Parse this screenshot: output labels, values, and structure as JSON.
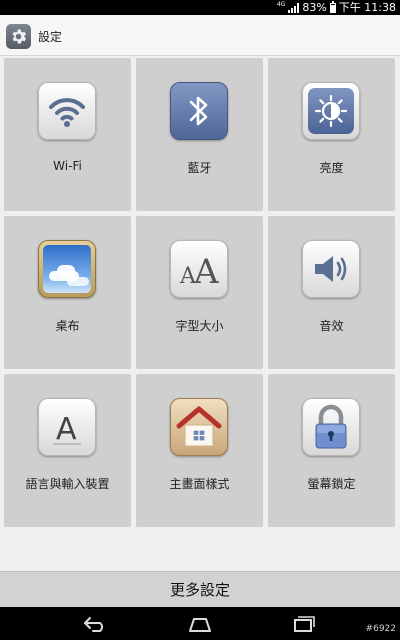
{
  "status_bar": {
    "network": "4G",
    "battery_percent": "83%",
    "time": "下午 11:38"
  },
  "header": {
    "icon": "gear-icon",
    "title": "設定"
  },
  "tiles": [
    {
      "label": "Wi-Fi",
      "icon": "wifi-icon"
    },
    {
      "label": "藍牙",
      "icon": "bluetooth-icon"
    },
    {
      "label": "亮度",
      "icon": "brightness-icon"
    },
    {
      "label": "桌布",
      "icon": "wallpaper-icon"
    },
    {
      "label": "字型大小",
      "icon": "font-size-icon"
    },
    {
      "label": "音效",
      "icon": "speaker-icon"
    },
    {
      "label": "語言與輸入裝置",
      "icon": "letter-a-icon"
    },
    {
      "label": "主畫面樣式",
      "icon": "home-icon"
    },
    {
      "label": "螢幕鎖定",
      "icon": "lock-icon"
    }
  ],
  "footer": {
    "more_label": "更多設定"
  },
  "nav": {
    "back": "back-icon",
    "home": "home-nav-icon",
    "recents": "recents-icon"
  },
  "watermark": "#6922"
}
